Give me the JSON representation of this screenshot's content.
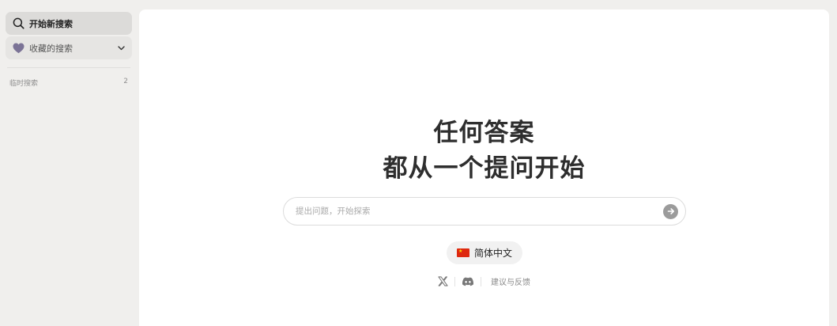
{
  "sidebar": {
    "new_search_label": "开始新搜索",
    "favorites_label": "收藏的搜索",
    "temp_section_label": "临时搜索",
    "temp_section_count": "2"
  },
  "main": {
    "headline_line1": "任何答案",
    "headline_line2": "都从一个提问开始",
    "search_placeholder": "提出问题，开始探索",
    "language_label": "简体中文",
    "feedback_label": "建议与反馈"
  },
  "icons": {
    "new_search": "search-icon",
    "favorites": "heart-icon",
    "expand": "chevron-down-icon",
    "send": "arrow-right-icon",
    "flag": "china-flag-icon",
    "x": "x-logo-icon",
    "discord": "discord-icon"
  },
  "colors": {
    "sidebar_bg": "#f0efed",
    "heart": "#7b7396",
    "send_button": "#9b9b9b"
  }
}
